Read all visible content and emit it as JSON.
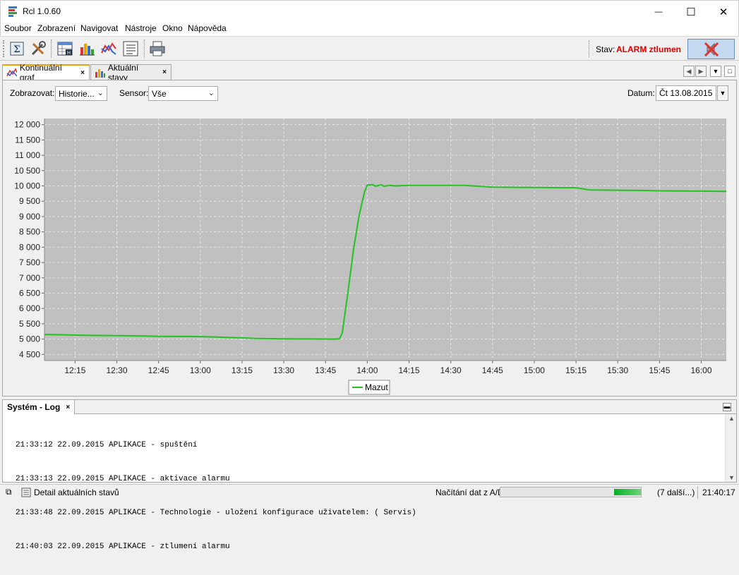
{
  "window": {
    "title": "Rcl 1.0.60",
    "minimize_glyph": "—",
    "maximize_glyph": "☐",
    "close_glyph": "✕"
  },
  "menu": [
    "Soubor",
    "Zobrazení",
    "Navigovat",
    "Nástroje",
    "Okno",
    "Nápověda"
  ],
  "toolbar": {
    "buttons": [
      "sum-report-icon",
      "tools-icon",
      "table-export-icon",
      "bar-chart-icon",
      "line-chart-icon",
      "list-icon",
      "print-icon"
    ],
    "status_label": "Stav:",
    "status_value": "ALARM ztlumen",
    "status_color": "#e00000",
    "alarm_button_icon": "alarm-mute-icon"
  },
  "tabs": [
    {
      "label": "Kontinuální graf",
      "close": "×",
      "active": true
    },
    {
      "label": "Aktuální stavy",
      "close": "×",
      "active": false
    }
  ],
  "filters": {
    "zobrazovat_label": "Zobrazovat:",
    "zobrazovat_value": "Historie...",
    "sensor_label": "Sensor:",
    "sensor_value": "Vše",
    "datum_label": "Datum:",
    "datum_value": "Čt 13.08.2015"
  },
  "chart_data": {
    "type": "line",
    "y_ticks": [
      "4 500",
      "5 000",
      "5 500",
      "6 000",
      "6 500",
      "7 000",
      "7 500",
      "8 000",
      "8 500",
      "9 000",
      "9 500",
      "10 000",
      "10 500",
      "11 000",
      "11 500",
      "12 000"
    ],
    "x_ticks": [
      "12:15",
      "12:30",
      "12:45",
      "13:00",
      "13:15",
      "13:30",
      "13:45",
      "14:00",
      "14:15",
      "14:30",
      "14:45",
      "15:00",
      "15:15",
      "15:30",
      "15:45",
      "16:00"
    ],
    "xlim": [
      "12:04",
      "16:09"
    ],
    "ylim": [
      4300,
      12200
    ],
    "grid": true,
    "legend_position": "bottom-center",
    "background": "#c0c0c0",
    "series": [
      {
        "name": "Mazut",
        "color": "#22c422",
        "points": [
          [
            "12:04",
            5150
          ],
          [
            "12:10",
            5140
          ],
          [
            "12:15",
            5130
          ],
          [
            "12:20",
            5120
          ],
          [
            "12:30",
            5110
          ],
          [
            "12:40",
            5100
          ],
          [
            "12:45",
            5090
          ],
          [
            "12:55",
            5085
          ],
          [
            "13:00",
            5080
          ],
          [
            "13:05",
            5070
          ],
          [
            "13:10",
            5050
          ],
          [
            "13:15",
            5040
          ],
          [
            "13:20",
            5020
          ],
          [
            "13:30",
            5010
          ],
          [
            "13:40",
            5005
          ],
          [
            "13:48",
            5000
          ],
          [
            "13:50",
            5010
          ],
          [
            "13:51",
            5200
          ],
          [
            "13:53",
            6500
          ],
          [
            "13:55",
            7900
          ],
          [
            "13:57",
            9000
          ],
          [
            "13:59",
            9800
          ],
          [
            "14:00",
            10030
          ],
          [
            "14:02",
            10040
          ],
          [
            "14:03",
            9990
          ],
          [
            "14:05",
            10040
          ],
          [
            "14:06",
            9990
          ],
          [
            "14:08",
            10020
          ],
          [
            "14:10",
            10000
          ],
          [
            "14:15",
            10020
          ],
          [
            "14:30",
            10020
          ],
          [
            "14:35",
            10020
          ],
          [
            "14:40",
            9990
          ],
          [
            "14:45",
            9960
          ],
          [
            "15:00",
            9950
          ],
          [
            "15:10",
            9940
          ],
          [
            "15:15",
            9940
          ],
          [
            "15:20",
            9870
          ],
          [
            "15:30",
            9860
          ],
          [
            "15:40",
            9850
          ],
          [
            "15:45",
            9840
          ],
          [
            "16:00",
            9830
          ],
          [
            "16:09",
            9820
          ]
        ]
      }
    ]
  },
  "log": {
    "title": "Systém - Log",
    "close": "×",
    "lines": [
      "21:33:12 22.09.2015 APLIKACE - spuštění",
      "21:33:13 22.09.2015 APLIKACE - aktivace alarmu",
      "21:33:48 22.09.2015 APLIKACE - Technologie - uložení konfigurace uživatelem: ( Servis)",
      "21:40:03 22.09.2015 APLIKACE - ztlumení alarmu"
    ]
  },
  "statusbar": {
    "detail_label": "Detail aktuálních stavů",
    "loading_label": "Načítání dat z A/D",
    "more_label": "(7 další...)",
    "time": "21:40:17",
    "progress_fraction": 0.19
  }
}
